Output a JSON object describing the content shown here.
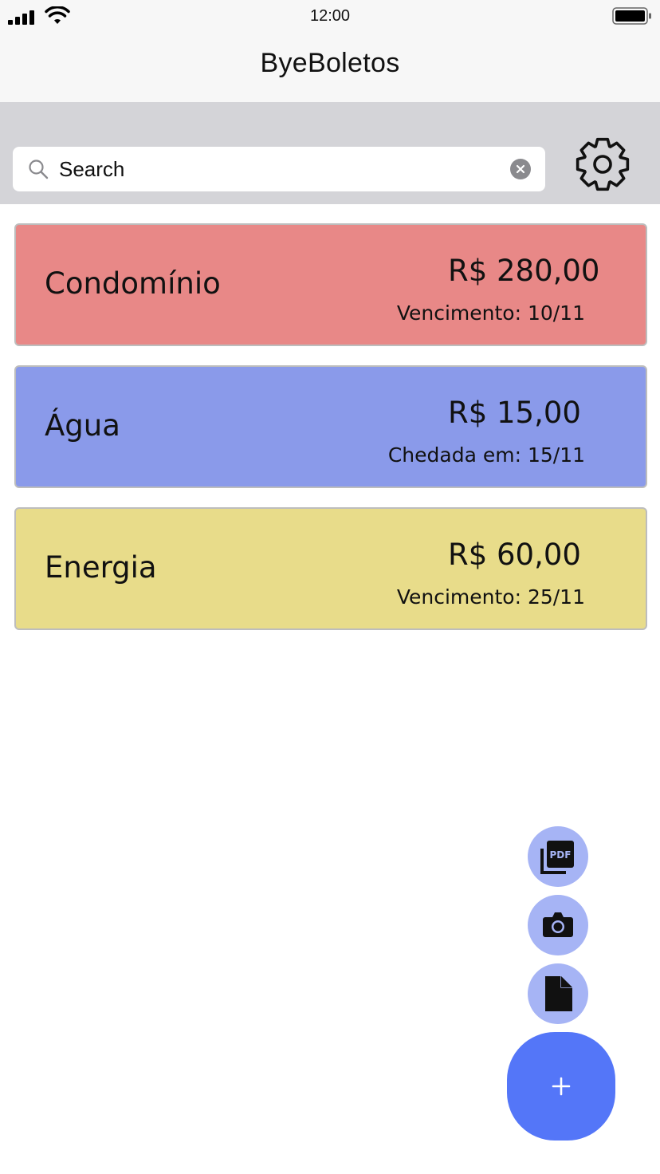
{
  "status_bar": {
    "time": "12:00"
  },
  "header": {
    "title": "ByeBoletos"
  },
  "search": {
    "placeholder": "Search"
  },
  "bills": [
    {
      "name": "Condomínio",
      "amount": "R$ 280,00",
      "date_text": "Vencimento: 10/11",
      "color": "#e88887"
    },
    {
      "name": "Água",
      "amount": "R$ 15,00",
      "date_text": "Chedada em: 15/11",
      "color": "#8a9aea"
    },
    {
      "name": "Energia",
      "amount": "R$ 60,00",
      "date_text": "Vencimento: 25/11",
      "color": "#e8dc8a"
    }
  ],
  "actions": [
    {
      "icon": "pdf-icon"
    },
    {
      "icon": "camera-icon"
    },
    {
      "icon": "document-icon"
    }
  ],
  "main_action": {
    "icon": "plus-icon"
  },
  "colors": {
    "fab": "#5476f8",
    "mini_fab": "#a6b4f5",
    "search_band": "#d4d4d8",
    "bar": "#f7f7f7"
  }
}
